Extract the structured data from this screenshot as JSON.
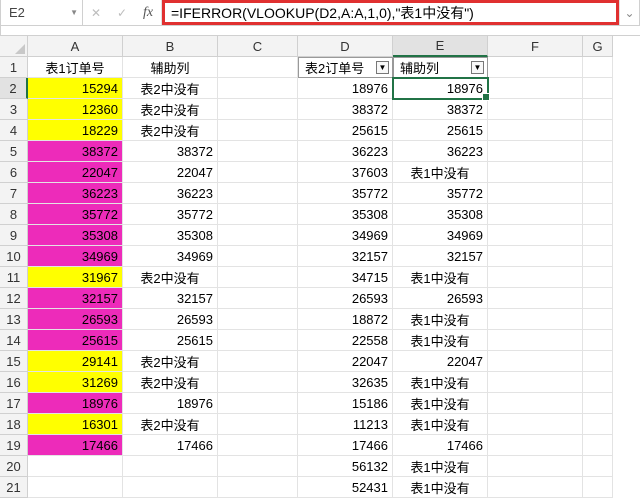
{
  "nameBox": "E2",
  "formula": "=IFERROR(VLOOKUP(D2,A:A,1,0),\"表1中没有\")",
  "fxLabel": "fx",
  "cancelIcon": "✕",
  "confirmIcon": "✓",
  "expandIcon": "⌄",
  "dropdownIcon": "▼",
  "columns": [
    "A",
    "B",
    "C",
    "D",
    "E",
    "F",
    "G"
  ],
  "activeCol": "E",
  "activeRow": 2,
  "headers": {
    "A": "表1订单号",
    "B": "辅助列",
    "D": "表2订单号",
    "E": "辅助列"
  },
  "filterCols": [
    "D",
    "E"
  ],
  "chart_data": {
    "type": "table",
    "title": "",
    "columns": [
      "row",
      "A",
      "A_fill",
      "B",
      "D",
      "E"
    ],
    "notes": "A_fill: yellow|magenta|none",
    "rows": [
      [
        2,
        "15294",
        "yellow",
        "表2中没有",
        "18976",
        "18976"
      ],
      [
        3,
        "12360",
        "yellow",
        "表2中没有",
        "38372",
        "38372"
      ],
      [
        4,
        "18229",
        "yellow",
        "表2中没有",
        "25615",
        "25615"
      ],
      [
        5,
        "38372",
        "magenta",
        "38372",
        "36223",
        "36223"
      ],
      [
        6,
        "22047",
        "magenta",
        "22047",
        "37603",
        "表1中没有"
      ],
      [
        7,
        "36223",
        "magenta",
        "36223",
        "35772",
        "35772"
      ],
      [
        8,
        "35772",
        "magenta",
        "35772",
        "35308",
        "35308"
      ],
      [
        9,
        "35308",
        "magenta",
        "35308",
        "34969",
        "34969"
      ],
      [
        10,
        "34969",
        "magenta",
        "34969",
        "32157",
        "32157"
      ],
      [
        11,
        "31967",
        "yellow",
        "表2中没有",
        "34715",
        "表1中没有"
      ],
      [
        12,
        "32157",
        "magenta",
        "32157",
        "26593",
        "26593"
      ],
      [
        13,
        "26593",
        "magenta",
        "26593",
        "18872",
        "表1中没有"
      ],
      [
        14,
        "25615",
        "magenta",
        "25615",
        "22558",
        "表1中没有"
      ],
      [
        15,
        "29141",
        "yellow",
        "表2中没有",
        "22047",
        "22047"
      ],
      [
        16,
        "31269",
        "yellow",
        "表2中没有",
        "32635",
        "表1中没有"
      ],
      [
        17,
        "18976",
        "magenta",
        "18976",
        "15186",
        "表1中没有"
      ],
      [
        18,
        "16301",
        "yellow",
        "表2中没有",
        "11213",
        "表1中没有"
      ],
      [
        19,
        "17466",
        "magenta",
        "17466",
        "17466",
        "17466"
      ],
      [
        20,
        "",
        "none",
        "",
        "56132",
        "表1中没有"
      ],
      [
        21,
        "",
        "none",
        "",
        "52431",
        "表1中没有"
      ]
    ]
  }
}
